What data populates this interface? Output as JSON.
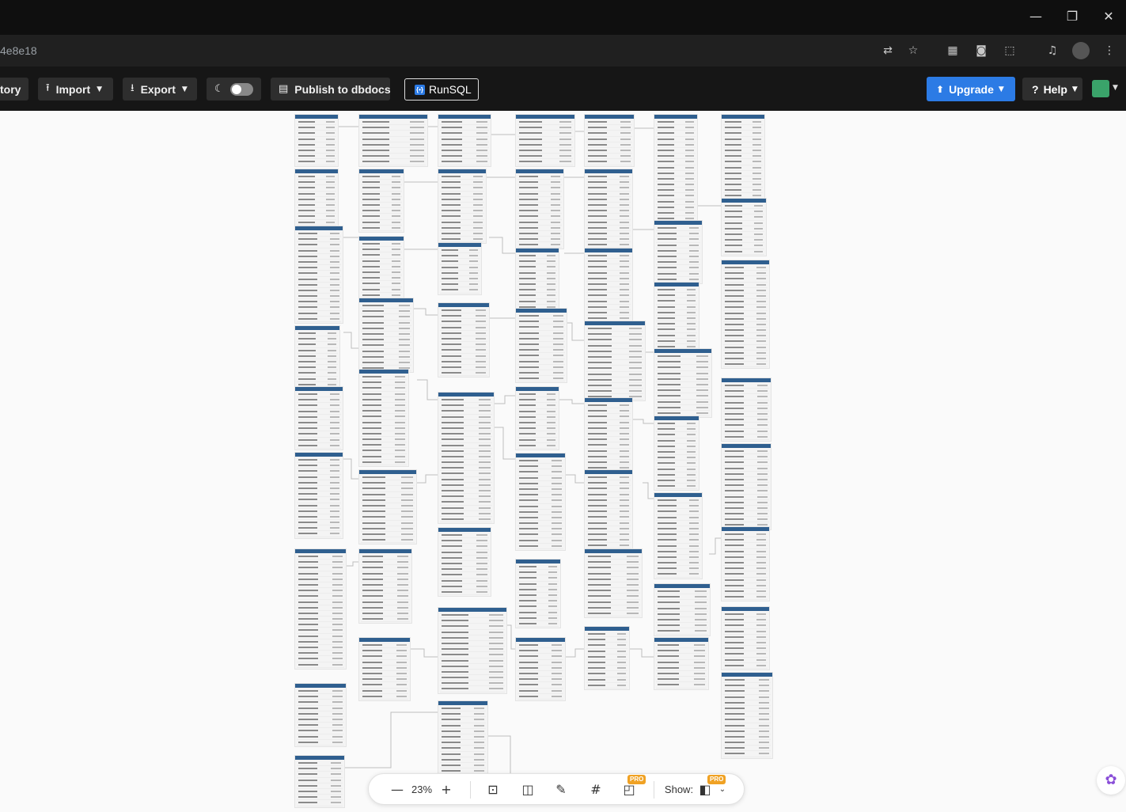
{
  "browser": {
    "url": "4e8e18",
    "window_buttons": {
      "minimize": "—",
      "restore": "❐",
      "close": "✕"
    },
    "icons": [
      "translate-icon",
      "star-icon",
      "qr-icon",
      "camera-icon",
      "extensions-icon",
      "media-icon",
      "profile-avatar",
      "menu-icon"
    ]
  },
  "toolbar": {
    "history_label": "tory",
    "import_label": "Import",
    "export_label": "Export",
    "publish_label": "Publish to dbdocs",
    "runsql_label": "RunSQL",
    "upgrade_label": "Upgrade",
    "help_label": "Help"
  },
  "zoom": {
    "level": "23%",
    "show_label": "Show:",
    "pro_badge": "PRO"
  },
  "colors": {
    "table_header": "#2f5f8f",
    "upgrade": "#2c7be5",
    "pro_badge": "#f0a224"
  }
}
